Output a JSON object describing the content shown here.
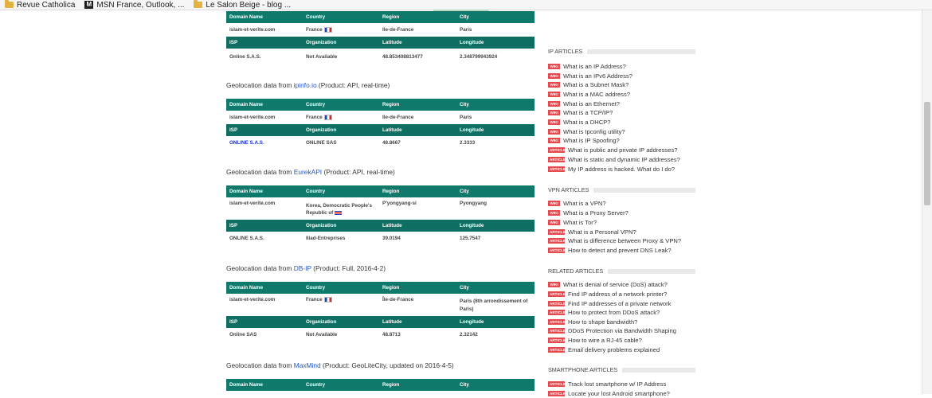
{
  "bookmarks": [
    {
      "label": "Revue Catholica",
      "icon": "folder-icon"
    },
    {
      "label": "MSN France, Outlook, ...",
      "icon": "msn-icon"
    },
    {
      "label": "Le Salon Beige - blog ...",
      "icon": "folder-icon"
    }
  ],
  "headers": {
    "domain": "Domain Name",
    "country": "Country",
    "region": "Region",
    "city": "City",
    "isp": "ISP",
    "organization": "Organization",
    "latitude": "Latitude",
    "longitude": "Longitude"
  },
  "blocks": [
    {
      "title_prefix": "",
      "source": "",
      "title_suffix": "",
      "domain": "islam-et-verite.com",
      "country": "France",
      "region": "Ile-de-France",
      "city": "Paris",
      "isp": "Online S.A.S.",
      "organization": "Not Available",
      "latitude": "48.853408813477",
      "longitude": "2.348799943924"
    },
    {
      "title_prefix": "Geolocation data from ",
      "source": "ipinfo.io",
      "title_suffix": " (Product: API, real-time)",
      "domain": "islam-et-verite.com",
      "country": "France",
      "region": "Ile-de-France",
      "city": "Paris",
      "isp": "ONLINE S.A.S.",
      "organization": "ONLINE SAS",
      "latitude": "48.8667",
      "longitude": "2.3333"
    },
    {
      "title_prefix": "Geolocation data from ",
      "source": "EurekAPI",
      "title_suffix": " (Product: API, real-time)",
      "domain": "islam-et-verite.com",
      "country": "Korea, Democratic People's Republic of",
      "region": "P'yongyang-si",
      "city": "Pyongyang",
      "isp": "ONLINE S.A.S.",
      "organization": "Iliad-Entreprises",
      "latitude": "39.0194",
      "longitude": "125.7547"
    },
    {
      "title_prefix": "Geolocation data from ",
      "source": "DB-IP",
      "title_suffix": " (Product: Full, 2016-4-2)",
      "domain": "islam-et-verite.com",
      "country": "France",
      "region": "Île-de-France",
      "city": "Paris (8th arrondissement of Paris)",
      "isp": "Online SAS",
      "organization": "Not Available",
      "latitude": "48.8713",
      "longitude": "2.32142"
    },
    {
      "title_prefix": "Geolocation data from ",
      "source": "MaxMind",
      "title_suffix": " (Product: GeoLiteCity, updated on 2016-4-5)"
    }
  ],
  "sidebar": {
    "sections": [
      {
        "title": "IP ARTICLES",
        "items": [
          {
            "badge": "WIKI",
            "label": "What is an IP Address?"
          },
          {
            "badge": "WIKI",
            "label": "What is an IPv6 Address?"
          },
          {
            "badge": "WIKI",
            "label": "What is a Subnet Mask?"
          },
          {
            "badge": "WIKI",
            "label": "What is a MAC address?"
          },
          {
            "badge": "WIKI",
            "label": "What is an Ethernet?"
          },
          {
            "badge": "WIKI",
            "label": "What is a TCP/IP?"
          },
          {
            "badge": "WIKI",
            "label": "What is a DHCP?"
          },
          {
            "badge": "WIKI",
            "label": "What is Ipconfig utility?"
          },
          {
            "badge": "WIKI",
            "label": "What is IP Spoofing?"
          },
          {
            "badge": "ARTICLE",
            "label": "What is public and private IP addresses?"
          },
          {
            "badge": "ARTICLE",
            "label": "What is static and dynamic IP addresses?"
          },
          {
            "badge": "ARTICLE",
            "label": "My IP address is hacked. What do I do?"
          }
        ]
      },
      {
        "title": "VPN ARTICLES",
        "items": [
          {
            "badge": "WIKI",
            "label": "What is a VPN?"
          },
          {
            "badge": "WIKI",
            "label": "What is a Proxy Server?"
          },
          {
            "badge": "WIKI",
            "label": "What is Tor?"
          },
          {
            "badge": "ARTICLE",
            "label": "What is a Personal VPN?"
          },
          {
            "badge": "ARTICLE",
            "label": "What is difference between Proxy & VPN?"
          },
          {
            "badge": "ARTICLE",
            "label": "How to detect and prevent DNS Leak?"
          }
        ]
      },
      {
        "title": "RELATED ARTICLES",
        "items": [
          {
            "badge": "WIKI",
            "label": "What is denial of service (DoS) attack?"
          },
          {
            "badge": "ARTICLE",
            "label": "Find IP address of a network printer?"
          },
          {
            "badge": "ARTICLE",
            "label": "Find IP addresses of a private network"
          },
          {
            "badge": "ARTICLE",
            "label": "How to protect from DDoS attack?"
          },
          {
            "badge": "ARTICLE",
            "label": "How to shape bandwidth?"
          },
          {
            "badge": "ARTICLE",
            "label": "DDoS Protection via Bandwidth Shaping"
          },
          {
            "badge": "ARTICLE",
            "label": "How to wire a RJ-45 cable?"
          },
          {
            "badge": "ARTICLE",
            "label": "Email delivery problems explained"
          }
        ]
      },
      {
        "title": "SMARTPHONE ARTICLES",
        "items": [
          {
            "badge": "ARTICLE",
            "label": "Track lost smartphone w/ IP Address"
          },
          {
            "badge": "ARTICLE",
            "label": "Locate your lost Android smartphone?"
          }
        ]
      }
    ]
  }
}
